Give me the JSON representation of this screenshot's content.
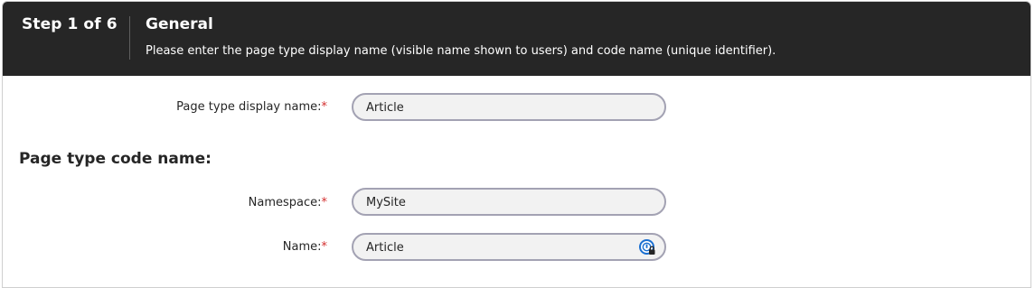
{
  "wizard": {
    "step_label": "Step 1 of 6",
    "section_title": "General",
    "section_description": "Please enter the page type display name (visible name shown to users) and code name (unique identifier)."
  },
  "form": {
    "required_marker": "*",
    "display_name": {
      "label": "Page type display name:",
      "value": "Article"
    },
    "code_name_heading": "Page type code name:",
    "namespace": {
      "label": "Namespace:",
      "value": "MySite"
    },
    "name": {
      "label": "Name:",
      "value": "Article",
      "icon": "password-manager-icon"
    }
  },
  "colors": {
    "header_bg": "#262626",
    "required": "#d32f2f",
    "field_border": "#a3a2b3",
    "field_bg": "#f2f2f2"
  }
}
